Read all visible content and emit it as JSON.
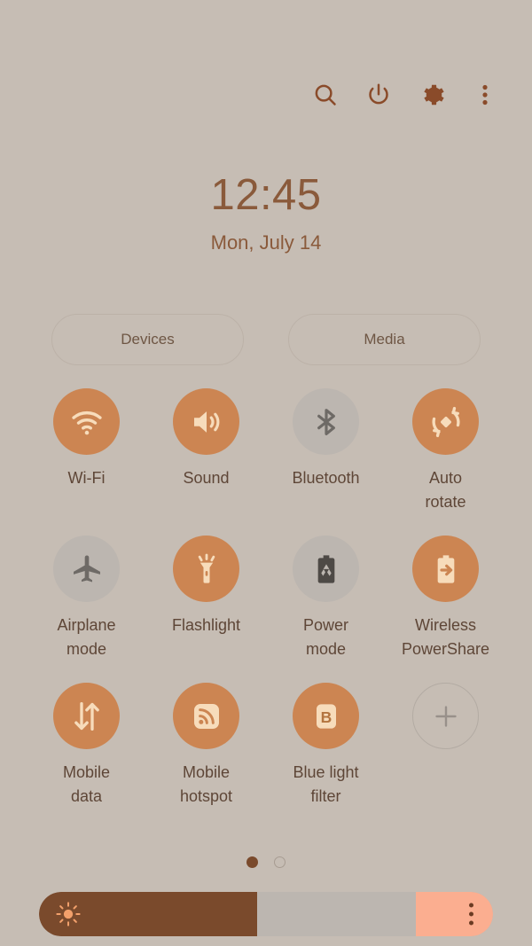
{
  "theme": {
    "background": "#C6BDB4",
    "accent_on": "#CC8552",
    "icon_on": "#F7DCBB",
    "inactive_circle": "#BCB6B0",
    "inactive_icon": "#6E6A66",
    "text_brown": "#5E4637",
    "clock_brown": "#8A5A3B",
    "slider_fill": "#7A4A2C",
    "slider_right": "#FBAE90"
  },
  "topbar": {
    "icons": [
      {
        "name": "search-icon",
        "label": "Search"
      },
      {
        "name": "power-icon",
        "label": "Power"
      },
      {
        "name": "settings-gear-icon",
        "label": "Settings"
      },
      {
        "name": "more-options-icon",
        "label": "More options"
      }
    ]
  },
  "clock": {
    "time": "12:45",
    "date": "Mon, July 14"
  },
  "shortcuts": {
    "devices_label": "Devices",
    "media_label": "Media"
  },
  "toggles": [
    {
      "label": "Wi-Fi",
      "icon": "wifi-icon",
      "state": "on"
    },
    {
      "label": "Sound",
      "icon": "sound-icon",
      "state": "on"
    },
    {
      "label": "Bluetooth",
      "icon": "bluetooth-icon",
      "state": "off"
    },
    {
      "label": "Auto\nrotate",
      "icon": "auto-rotate-icon",
      "state": "on"
    },
    {
      "label": "Airplane\nmode",
      "icon": "airplane-icon",
      "state": "off"
    },
    {
      "label": "Flashlight",
      "icon": "flashlight-icon",
      "state": "on"
    },
    {
      "label": "Power\nmode",
      "icon": "power-mode-icon",
      "state": "off"
    },
    {
      "label": "Wireless\nPowerShare",
      "icon": "power-share-icon",
      "state": "on"
    },
    {
      "label": "Mobile\ndata",
      "icon": "mobile-data-icon",
      "state": "on"
    },
    {
      "label": "Mobile\nhotspot",
      "icon": "mobile-hotspot-icon",
      "state": "on"
    },
    {
      "label": "Blue light\nfilter",
      "icon": "blue-light-icon",
      "state": "on"
    },
    {
      "label": "",
      "icon": "add-icon",
      "state": "add"
    }
  ],
  "pager": {
    "pages": 2,
    "active_index": 0
  },
  "brightness": {
    "icon": "brightness-sun-icon",
    "percent": 48,
    "right_section_percent": 17,
    "menu_icon": "brightness-options-icon"
  }
}
